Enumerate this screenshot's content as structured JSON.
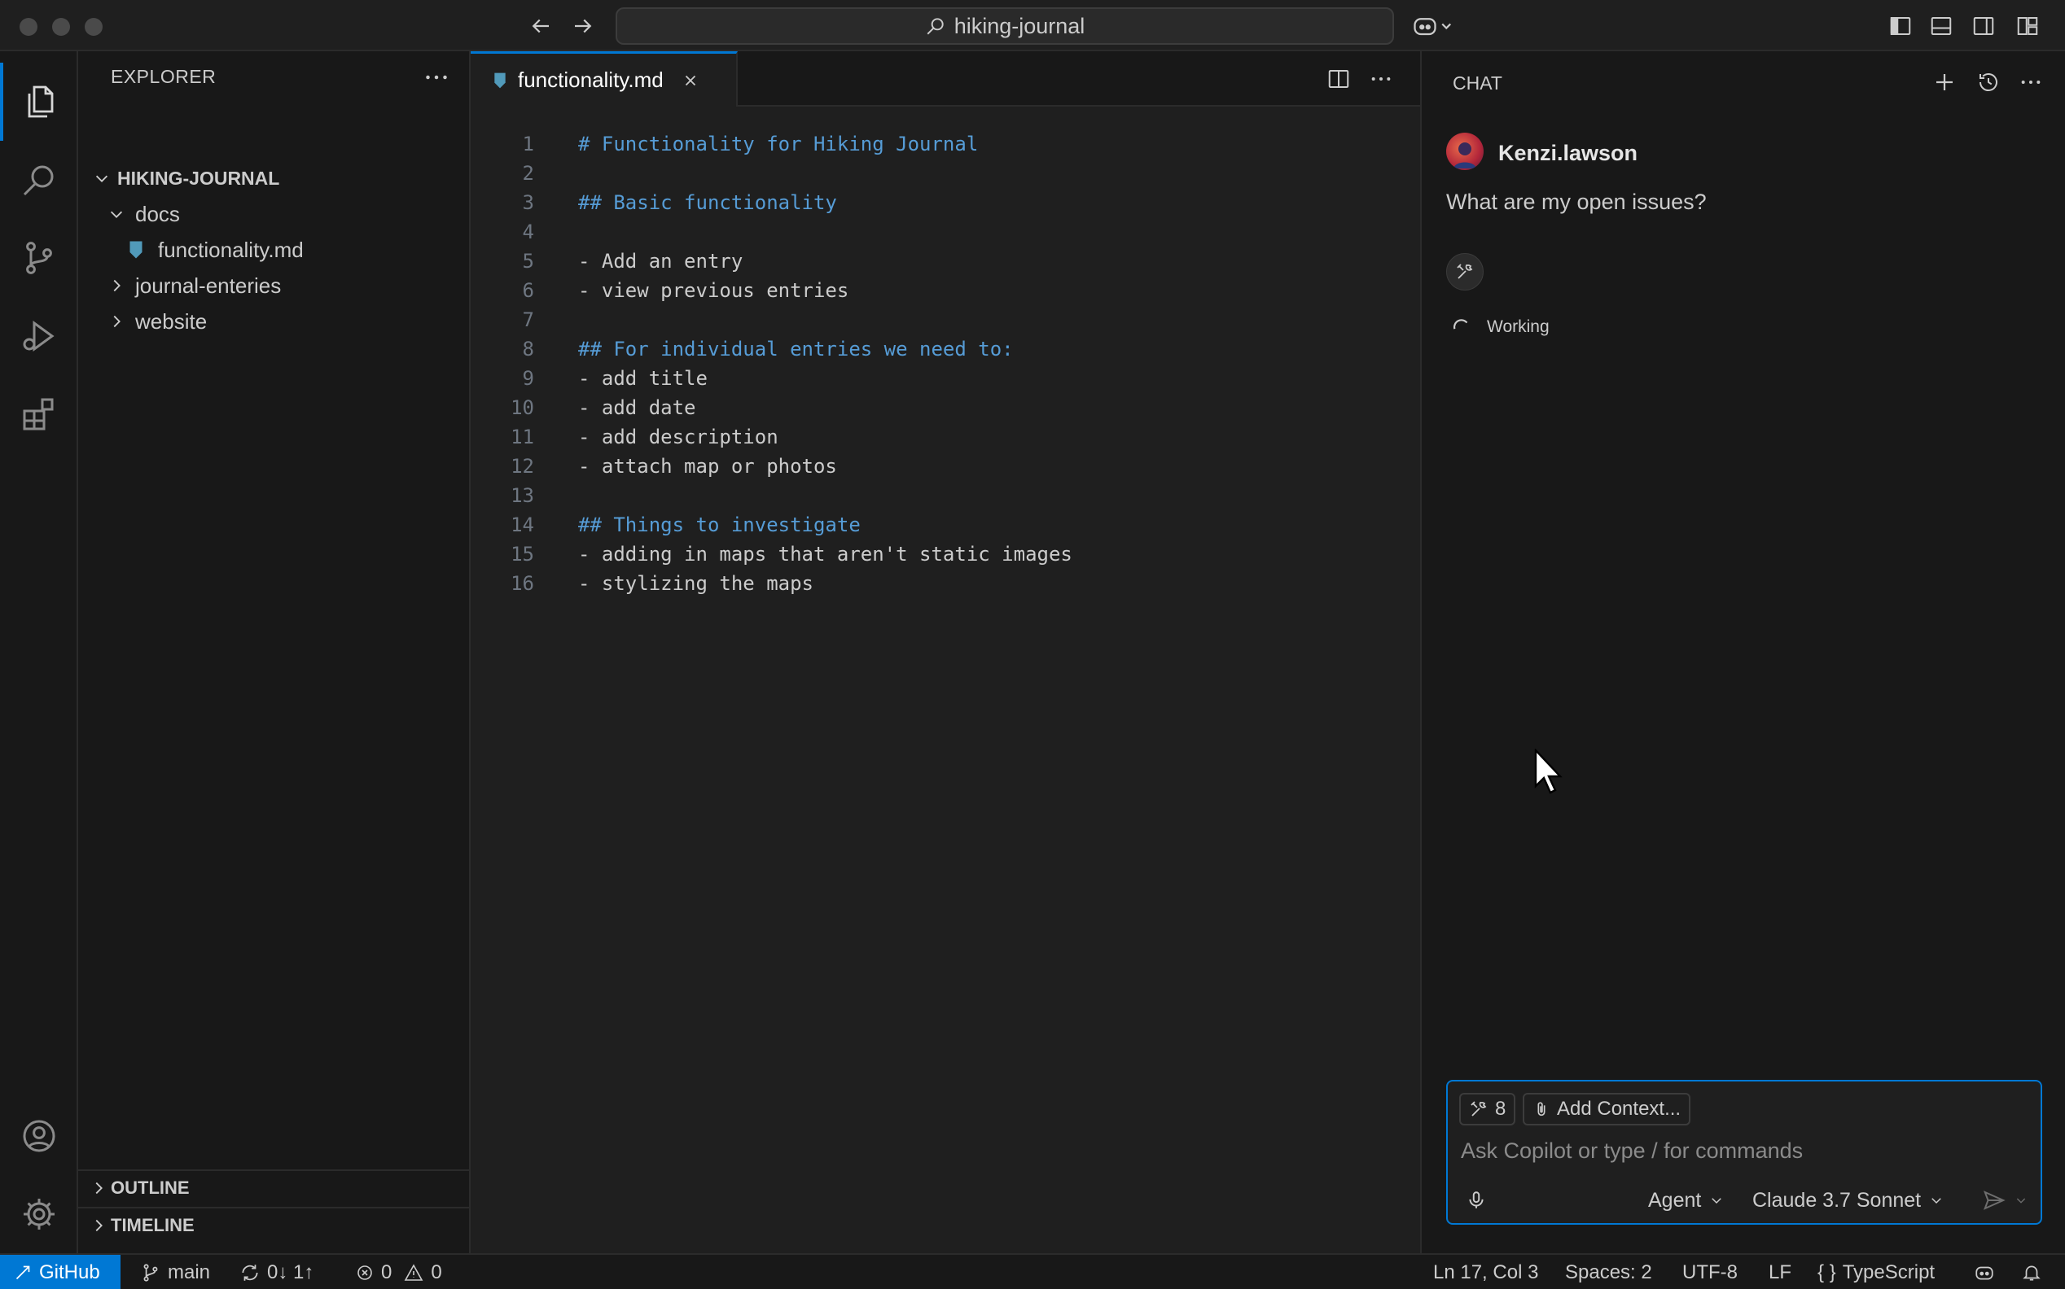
{
  "titlebar": {
    "search_text": "hiking-journal"
  },
  "sidebar": {
    "header": "EXPLORER",
    "root": "HIKING-JOURNAL",
    "tree": [
      {
        "label": "docs",
        "type": "folder",
        "expanded": true
      },
      {
        "label": "functionality.md",
        "type": "file"
      },
      {
        "label": "journal-enteries",
        "type": "folder",
        "expanded": false
      },
      {
        "label": "website",
        "type": "folder",
        "expanded": false
      }
    ],
    "outline": "OUTLINE",
    "timeline": "TIMELINE"
  },
  "editor": {
    "tab_label": "functionality.md",
    "lines": [
      {
        "n": "1",
        "text": "# Functionality for Hiking Journal",
        "heading": true
      },
      {
        "n": "2",
        "text": "",
        "heading": false
      },
      {
        "n": "3",
        "text": "## Basic functionality",
        "heading": true
      },
      {
        "n": "4",
        "text": "",
        "heading": false
      },
      {
        "n": "5",
        "text": "- Add an entry",
        "heading": false
      },
      {
        "n": "6",
        "text": "- view previous entries",
        "heading": false
      },
      {
        "n": "7",
        "text": "",
        "heading": false
      },
      {
        "n": "8",
        "text": "## For individual entries we need to:",
        "heading": true
      },
      {
        "n": "9",
        "text": "- add title",
        "heading": false
      },
      {
        "n": "10",
        "text": "- add date",
        "heading": false
      },
      {
        "n": "11",
        "text": "- add description",
        "heading": false
      },
      {
        "n": "12",
        "text": "- attach map or photos",
        "heading": false
      },
      {
        "n": "13",
        "text": "",
        "heading": false
      },
      {
        "n": "14",
        "text": "## Things to investigate",
        "heading": true
      },
      {
        "n": "15",
        "text": "- adding in maps that aren't static images",
        "heading": false
      },
      {
        "n": "16",
        "text": "- stylizing the maps",
        "heading": false
      }
    ]
  },
  "chat": {
    "title": "CHAT",
    "username": "Kenzi.lawson",
    "question": "What are my open issues?",
    "status": "Working",
    "tools_count": "8",
    "add_context": "Add Context...",
    "placeholder": "Ask Copilot or type / for commands",
    "mode": "Agent",
    "model": "Claude 3.7 Sonnet"
  },
  "statusbar": {
    "remote": "GitHub",
    "branch": "main",
    "sync": "0↓ 1↑",
    "errors": "0",
    "warnings": "0",
    "position": "Ln 17, Col 3",
    "spaces": "Spaces: 2",
    "encoding": "UTF-8",
    "eol": "LF",
    "language": "TypeScript"
  },
  "colors": {
    "accent": "#0078d4",
    "heading": "#569cd6",
    "background": "#181818",
    "editor_bg": "#1f1f1f"
  }
}
